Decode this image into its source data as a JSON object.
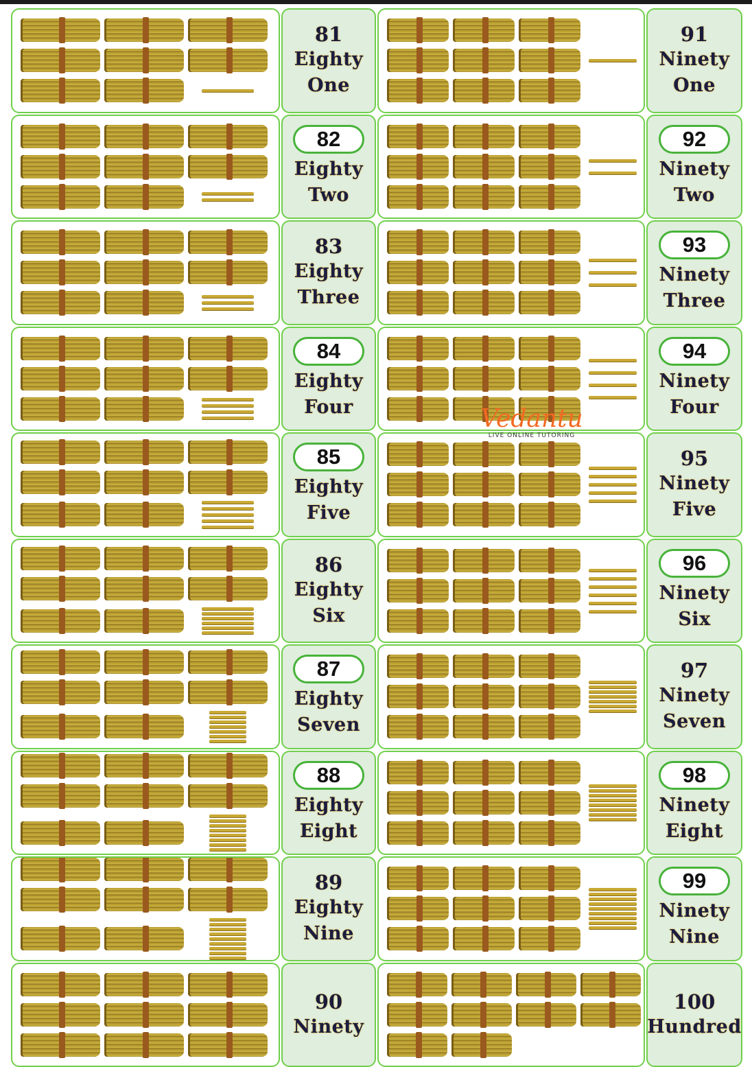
{
  "logo": {
    "brand": "Vedantu",
    "tagline": "LIVE ONLINE TUTORING",
    "color": "#f26a22"
  },
  "colors": {
    "border": "#6fcf4a",
    "label_bg": "#dfeedd",
    "stick": "#c9a934",
    "band": "#9a5a1e"
  },
  "rows": [
    {
      "left": {
        "number": "81",
        "words": [
          "Eighty",
          "One"
        ],
        "pill": false,
        "bundles": 8,
        "sticks": 1
      },
      "right": {
        "number": "91",
        "words": [
          "Ninety",
          "One"
        ],
        "pill": false,
        "bundles": 9,
        "sticks": 1
      }
    },
    {
      "left": {
        "number": "82",
        "words": [
          "Eighty",
          "Two"
        ],
        "pill": true,
        "bundles": 8,
        "sticks": 2
      },
      "right": {
        "number": "92",
        "words": [
          "Ninety",
          "Two"
        ],
        "pill": true,
        "bundles": 9,
        "sticks": 2
      }
    },
    {
      "left": {
        "number": "83",
        "words": [
          "Eighty",
          "Three"
        ],
        "pill": false,
        "bundles": 8,
        "sticks": 3
      },
      "right": {
        "number": "93",
        "words": [
          "Ninety",
          "Three"
        ],
        "pill": true,
        "bundles": 9,
        "sticks": 3
      }
    },
    {
      "left": {
        "number": "84",
        "words": [
          "Eighty",
          "Four"
        ],
        "pill": true,
        "bundles": 8,
        "sticks": 4
      },
      "right": {
        "number": "94",
        "words": [
          "Ninety",
          "Four"
        ],
        "pill": true,
        "bundles": 9,
        "sticks": 4
      }
    },
    {
      "left": {
        "number": "85",
        "words": [
          "Eighty",
          "Five"
        ],
        "pill": true,
        "bundles": 8,
        "sticks": 5
      },
      "right": {
        "number": "95",
        "words": [
          "Ninety",
          "Five"
        ],
        "pill": false,
        "bundles": 9,
        "sticks": 5
      }
    },
    {
      "left": {
        "number": "86",
        "words": [
          "Eighty",
          "Six"
        ],
        "pill": false,
        "bundles": 8,
        "sticks": 6
      },
      "right": {
        "number": "96",
        "words": [
          "Ninety",
          "Six"
        ],
        "pill": true,
        "bundles": 9,
        "sticks": 6
      }
    },
    {
      "left": {
        "number": "87",
        "words": [
          "Eighty",
          "Seven"
        ],
        "pill": true,
        "bundles": 8,
        "sticks": 7
      },
      "right": {
        "number": "97",
        "words": [
          "Ninety",
          "Seven"
        ],
        "pill": false,
        "bundles": 9,
        "sticks": 7
      }
    },
    {
      "left": {
        "number": "88",
        "words": [
          "Eighty",
          "Eight"
        ],
        "pill": true,
        "bundles": 8,
        "sticks": 8
      },
      "right": {
        "number": "98",
        "words": [
          "Ninety",
          "Eight"
        ],
        "pill": true,
        "bundles": 9,
        "sticks": 8
      }
    },
    {
      "left": {
        "number": "89",
        "words": [
          "Eighty",
          "Nine"
        ],
        "pill": false,
        "bundles": 8,
        "sticks": 9
      },
      "right": {
        "number": "99",
        "words": [
          "Ninety",
          "Nine"
        ],
        "pill": true,
        "bundles": 9,
        "sticks": 9
      }
    },
    {
      "left": {
        "number": "90",
        "words": [
          "Ninety"
        ],
        "pill": false,
        "bundles": 9,
        "sticks": 0
      },
      "right": {
        "number": "100",
        "words": [
          "Hundred"
        ],
        "pill": false,
        "bundles": 10,
        "sticks": 0
      }
    }
  ]
}
